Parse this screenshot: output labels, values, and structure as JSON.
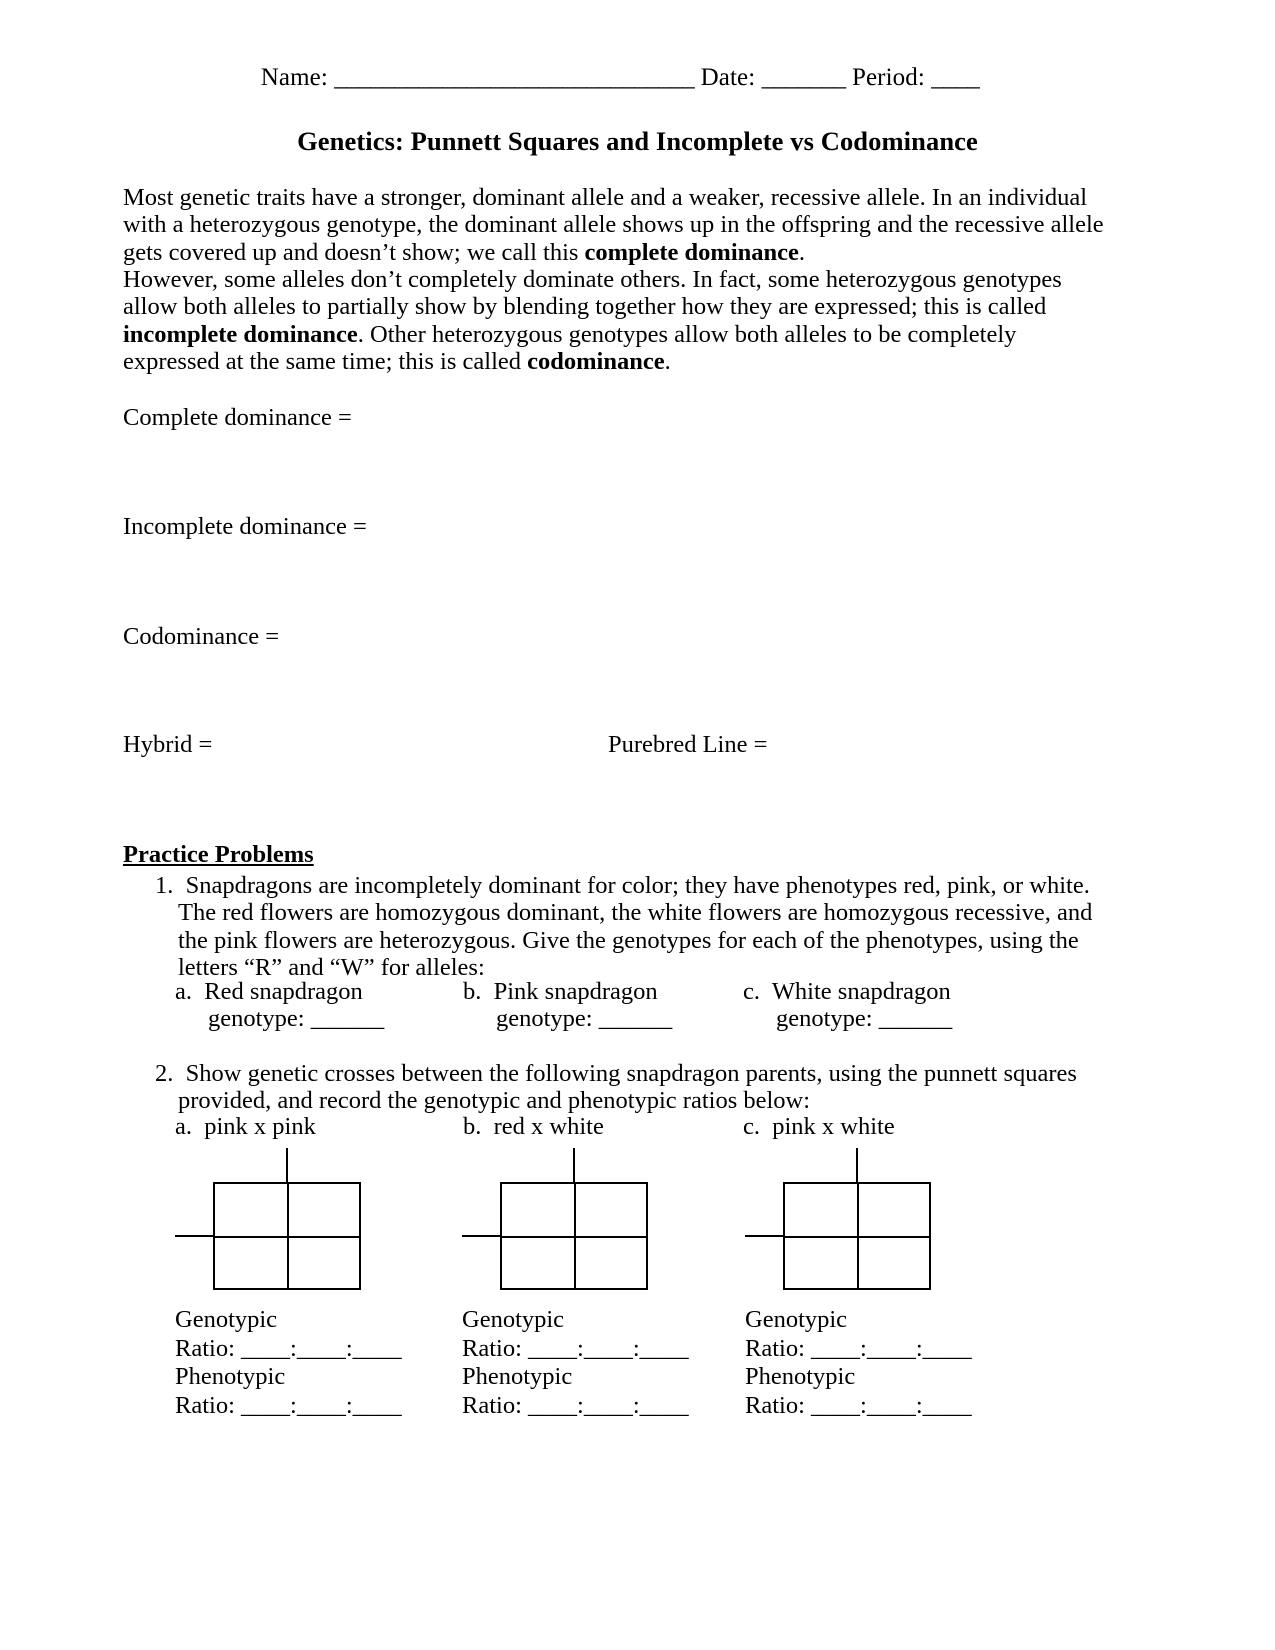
{
  "header": {
    "name_label": "Name:",
    "name_rule": "______________________________",
    "date_label": "Date:",
    "date_rule": "_______",
    "period_label": "Period:",
    "period_rule": "____"
  },
  "title": "Genetics:  Punnett Squares and Incomplete vs Codominance",
  "paragraphs": {
    "p1_a": "Most genetic traits have a stronger, dominant allele and a weaker, recessive allele.  In an individual with a heterozygous genotype, the dominant allele shows up in the offspring and the recessive allele gets covered up and doesn’t show; we call this ",
    "p1_bold": "complete dominance",
    "p1_b": ".",
    "p2_a": "However, some alleles don’t completely dominate others.  In fact, some heterozygous genotypes allow both alleles to partially show by blending together how they are expressed; this is called ",
    "p2_bold1": "incomplete dominance",
    "p2_b": ".  Other heterozygous genotypes allow both alleles to be completely expressed at the same time; this is called ",
    "p2_bold2": "codominance",
    "p2_c": "."
  },
  "definitions": [
    {
      "label": "Complete dominance ="
    },
    {
      "label": "Incomplete dominance ="
    },
    {
      "label": "Codominance ="
    }
  ],
  "terms": {
    "hybrid": "Hybrid =",
    "purebred": "Purebred Line ="
  },
  "practice": {
    "heading": "Practice Problems",
    "q1": {
      "number": "1.",
      "text": "Snapdragons are incompletely dominant for color; they have phenotypes red, pink, or white.  The red flowers are homozygous dominant, the white flowers are homozygous recessive, and the pink flowers are heterozygous.  Give the genotypes for each of the phenotypes, using the letters “R” and “W” for alleles:",
      "options": [
        {
          "marker": "a.",
          "name": "Red snapdragon",
          "field_label": "genotype:",
          "field_rule": "______"
        },
        {
          "marker": "b.",
          "name": "Pink snapdragon",
          "field_label": "genotype:",
          "field_rule": "______"
        },
        {
          "marker": "c.",
          "name": "White snapdragon",
          "field_label": "genotype:",
          "field_rule": "______"
        }
      ]
    },
    "q2": {
      "number": "2.",
      "text": "Show genetic crosses between the following snapdragon parents, using the punnett squares provided, and record the genotypic and phenotypic ratios below:",
      "crosses": [
        {
          "marker": "a.",
          "label": "pink x pink"
        },
        {
          "marker": "b.",
          "label": "red x white"
        },
        {
          "marker": "c.",
          "label": "pink x white"
        }
      ],
      "ratios": [
        {
          "genotypic_label": "Genotypic",
          "genotypic_value": "Ratio:  ____:____:____",
          "phenotypic_label": "Phenotypic",
          "phenotypic_value": "Ratio:  ____:____:____"
        },
        {
          "genotypic_label": "Genotypic",
          "genotypic_value": "Ratio:  ____:____:____",
          "phenotypic_label": "Phenotypic",
          "phenotypic_value": "Ratio:  ____:____:____"
        },
        {
          "genotypic_label": "Genotypic",
          "genotypic_value": "Ratio:  ____:____:____",
          "phenotypic_label": "Phenotypic",
          "phenotypic_value": "Ratio:  ____:____:____"
        }
      ]
    }
  }
}
